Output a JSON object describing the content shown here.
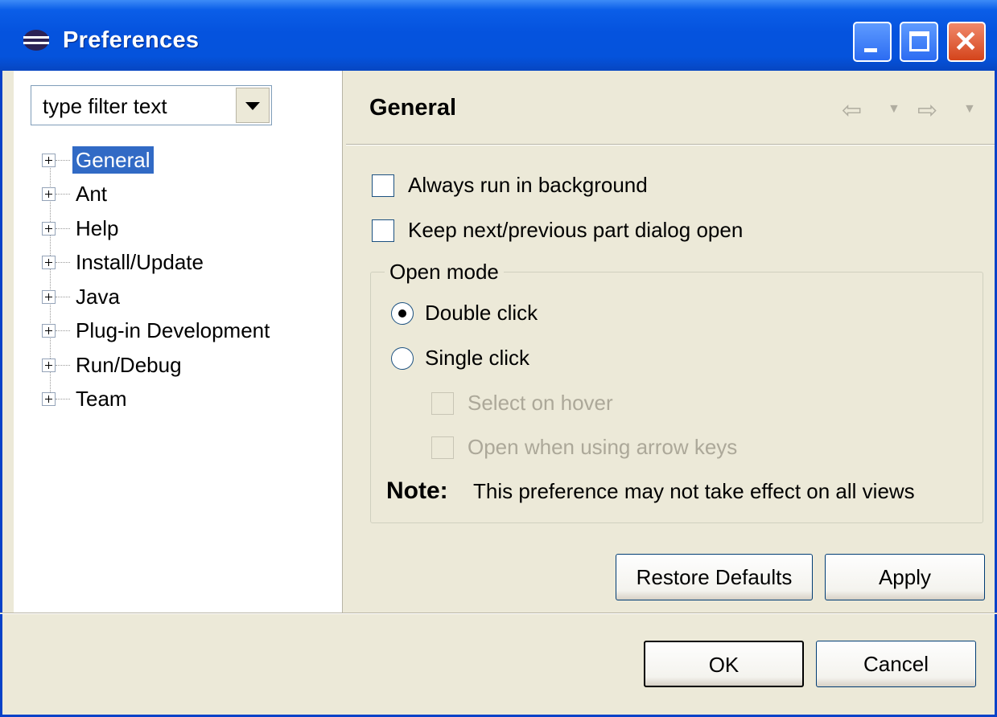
{
  "window": {
    "title": "Preferences",
    "buttons": {
      "minimize": "minimize",
      "maximize": "maximize",
      "close": "close"
    }
  },
  "filter": {
    "value": "type filter text"
  },
  "tree": {
    "items": [
      {
        "label": "General",
        "selected": true
      },
      {
        "label": "Ant"
      },
      {
        "label": "Help"
      },
      {
        "label": "Install/Update"
      },
      {
        "label": "Java"
      },
      {
        "label": "Plug-in Development"
      },
      {
        "label": "Run/Debug"
      },
      {
        "label": "Team"
      }
    ]
  },
  "page": {
    "title": "General",
    "always_run_in_background": {
      "label": "Always run in background",
      "checked": false
    },
    "keep_dialog_open": {
      "label": "Keep next/previous part dialog open",
      "checked": false
    },
    "open_mode": {
      "title": "Open mode",
      "double_click": {
        "label": "Double click",
        "selected": true
      },
      "single_click": {
        "label": "Single click",
        "selected": false
      },
      "select_on_hover": {
        "label": "Select on hover",
        "enabled": false
      },
      "open_with_arrow_keys": {
        "label": "Open when using arrow keys",
        "enabled": false
      },
      "note_label": "Note:",
      "note_text": "This preference may not take effect on all views"
    },
    "restore_defaults": "Restore Defaults",
    "apply": "Apply"
  },
  "dialog": {
    "ok": "OK",
    "cancel": "Cancel"
  },
  "colors": {
    "titlebar": "#0553de",
    "selection": "#316ac5",
    "dialog_bg": "#ece9d8"
  }
}
